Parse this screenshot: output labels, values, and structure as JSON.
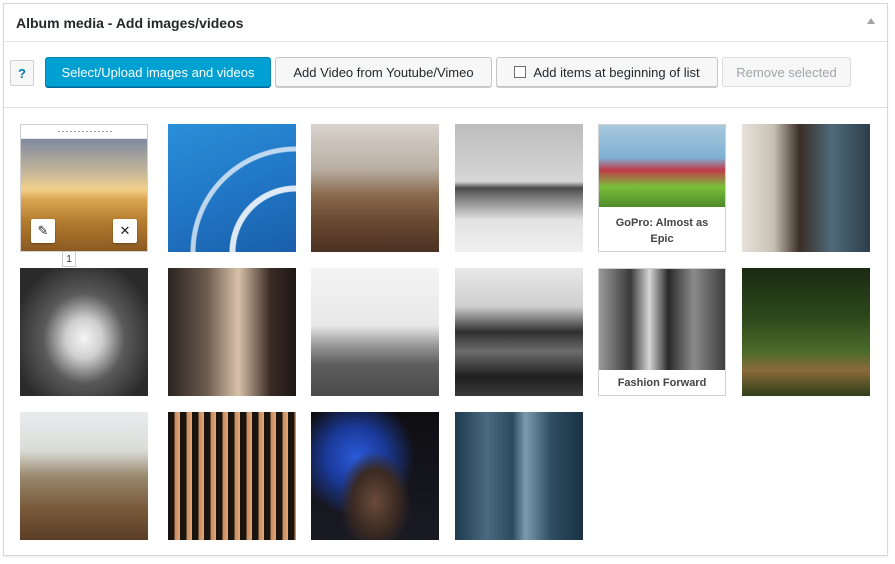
{
  "panel": {
    "title": "Album media - Add images/videos"
  },
  "toolbar": {
    "help_label": "?",
    "select_upload_label": "Select/Upload images and videos",
    "add_video_label": "Add Video from Youtube/Vimeo",
    "add_beginning_label": "Add items at beginning of list",
    "add_beginning_checked": false,
    "remove_selected_label": "Remove selected"
  },
  "media": [
    {
      "caption": "",
      "order": "1"
    },
    {
      "caption": ""
    },
    {
      "caption": ""
    },
    {
      "caption": ""
    },
    {
      "caption": "GoPro: Almost as Epic"
    },
    {
      "caption": ""
    },
    {
      "caption": ""
    },
    {
      "caption": ""
    },
    {
      "caption": ""
    },
    {
      "caption": ""
    },
    {
      "caption": "Fashion Forward"
    },
    {
      "caption": ""
    },
    {
      "caption": ""
    },
    {
      "caption": ""
    },
    {
      "caption": ""
    },
    {
      "caption": ""
    }
  ],
  "colors": {
    "primary_button": "#00a0d2",
    "help_icon": "#0073aa"
  }
}
